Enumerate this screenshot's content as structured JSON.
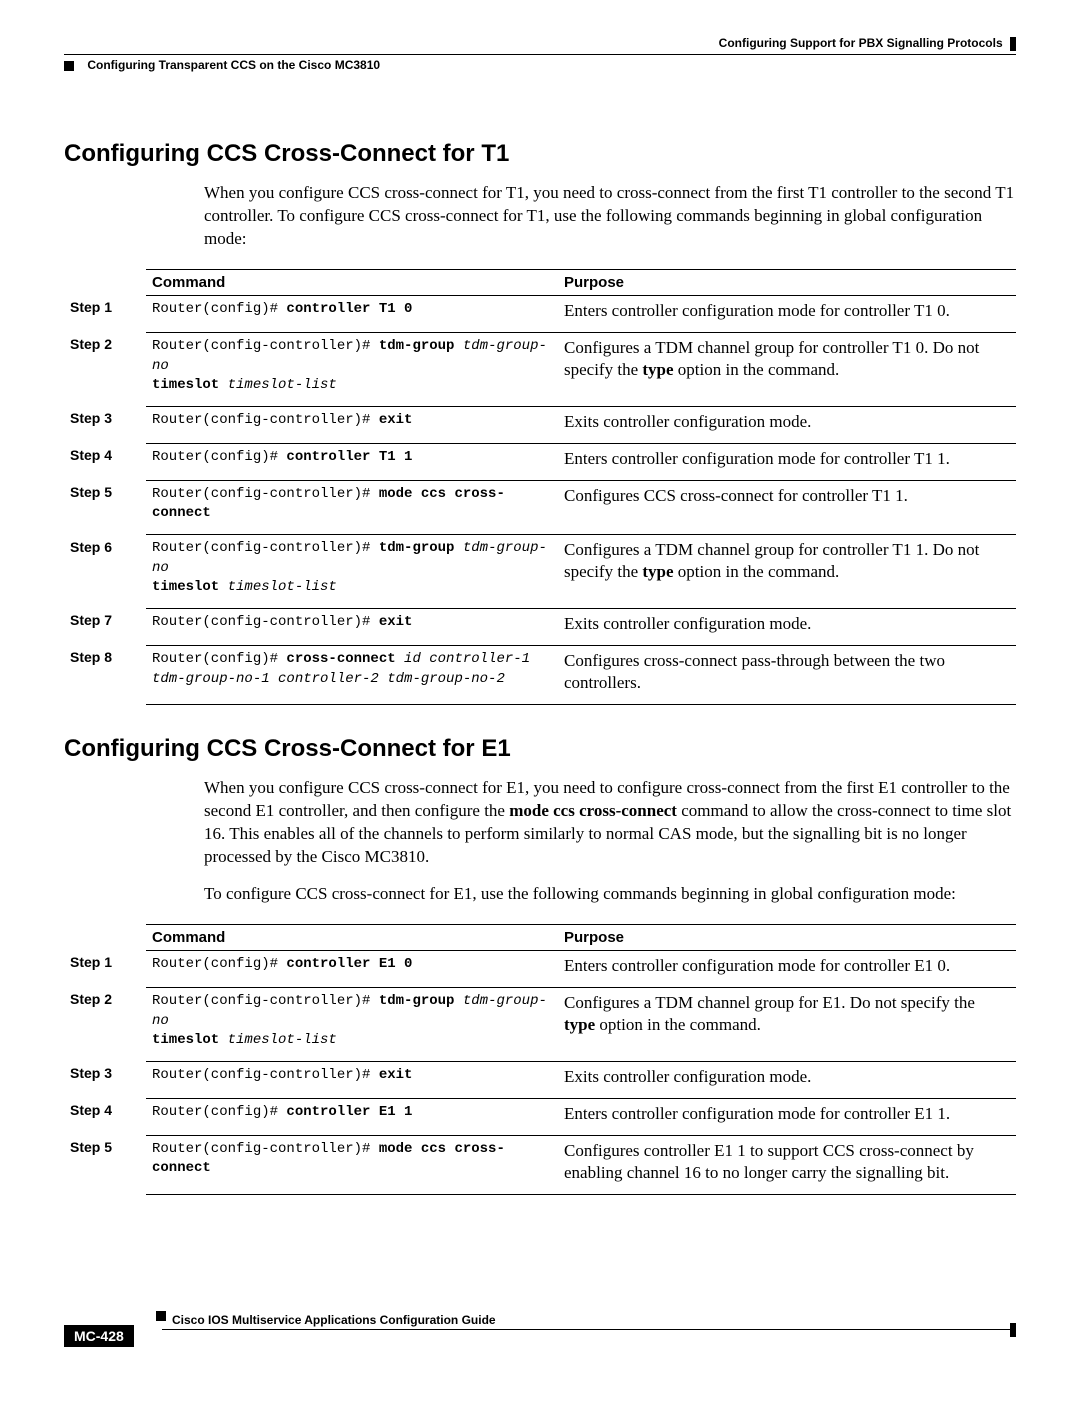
{
  "header": {
    "chapter": "Configuring Support for PBX Signalling Protocols",
    "section": "Configuring Transparent CCS on the Cisco MC3810"
  },
  "t1": {
    "title": "Configuring CCS Cross-Connect for T1",
    "intro": "When you configure CCS cross-connect for T1, you need to cross-connect from the first T1 controller to the second T1 controller. To configure CCS cross-connect for T1, use the following commands beginning in global configuration mode:",
    "th_step": "",
    "th_command": "Command",
    "th_purpose": "Purpose",
    "rows": [
      {
        "step": "Step 1",
        "prompt": "Router(config)# ",
        "cmd_bold": "controller T1 0",
        "cmd_args": "",
        "line2_bold": "",
        "line2_args": "",
        "purpose_a": "Enters controller configuration mode for controller T1 0.",
        "purpose_b": ""
      },
      {
        "step": "Step 2",
        "prompt": "Router(config-controller)# ",
        "cmd_bold": "tdm-group",
        "cmd_args": " tdm-group-no",
        "line2_bold": "timeslot",
        "line2_args": " timeslot-list",
        "purpose_a": "Configures a TDM channel group for controller T1 0. Do not specify the ",
        "purpose_bold": "type",
        "purpose_b": " option in the command."
      },
      {
        "step": "Step 3",
        "prompt": "Router(config-controller)# ",
        "cmd_bold": "exit",
        "cmd_args": "",
        "line2_bold": "",
        "line2_args": "",
        "purpose_a": "Exits controller configuration mode.",
        "purpose_b": ""
      },
      {
        "step": "Step 4",
        "prompt": "Router(config)# ",
        "cmd_bold": "controller T1 1",
        "cmd_args": "",
        "line2_bold": "",
        "line2_args": "",
        "purpose_a": "Enters controller configuration mode for controller T1 1.",
        "purpose_b": ""
      },
      {
        "step": "Step 5",
        "prompt": "Router(config-controller)# ",
        "cmd_bold": "mode ccs cross-connect",
        "cmd_args": "",
        "line2_bold": "",
        "line2_args": "",
        "purpose_a": "Configures CCS cross-connect for controller T1 1.",
        "purpose_b": ""
      },
      {
        "step": "Step 6",
        "prompt": "Router(config-controller)# ",
        "cmd_bold": "tdm-group",
        "cmd_args": " tdm-group-no",
        "line2_bold": "timeslot",
        "line2_args": " timeslot-list",
        "purpose_a": "Configures a TDM channel group for controller T1 1. Do not specify the ",
        "purpose_bold": "type",
        "purpose_b": " option in the command."
      },
      {
        "step": "Step 7",
        "prompt": "Router(config-controller)# ",
        "cmd_bold": "exit",
        "cmd_args": "",
        "line2_bold": "",
        "line2_args": "",
        "purpose_a": "Exits controller configuration mode.",
        "purpose_b": ""
      },
      {
        "step": "Step 8",
        "prompt": "Router(config)# ",
        "cmd_bold": "cross-connect",
        "cmd_args": " id controller-1 tdm-group-no-1 controller-2 tdm-group-no-2",
        "line2_bold": "",
        "line2_args": "",
        "purpose_a": "Configures cross-connect pass-through between the two controllers.",
        "purpose_b": ""
      }
    ]
  },
  "e1": {
    "title": "Configuring CCS Cross-Connect for E1",
    "intro1a": "When you configure CCS cross-connect for E1, you need to configure cross-connect from the first E1 controller to the second E1 controller, and then configure the ",
    "intro1_bold": "mode ccs cross-connect",
    "intro1b": " command to allow the cross-connect to time slot 16. This enables all of the channels to perform similarly to normal CAS mode, but the signalling bit is no longer processed by the Cisco MC3810.",
    "intro2": "To configure CCS cross-connect for E1, use the following commands beginning in global configuration mode:",
    "th_command": "Command",
    "th_purpose": "Purpose",
    "rows": [
      {
        "step": "Step 1",
        "prompt": "Router(config)# ",
        "cmd_bold": "controller E1 0",
        "cmd_args": "",
        "line2_bold": "",
        "line2_args": "",
        "purpose_a": "Enters controller configuration mode for controller E1 0.",
        "purpose_b": ""
      },
      {
        "step": "Step 2",
        "prompt": "Router(config-controller)# ",
        "cmd_bold": "tdm-group",
        "cmd_args": " tdm-group-no",
        "line2_bold": "timeslot",
        "line2_args": " timeslot-list",
        "purpose_a": "Configures a TDM channel group for E1. Do not specify the ",
        "purpose_bold": "type",
        "purpose_b": " option in the command."
      },
      {
        "step": "Step 3",
        "prompt": "Router(config-controller)# ",
        "cmd_bold": "exit",
        "cmd_args": "",
        "line2_bold": "",
        "line2_args": "",
        "purpose_a": "Exits controller configuration mode.",
        "purpose_b": ""
      },
      {
        "step": "Step 4",
        "prompt": "Router(config)# ",
        "cmd_bold": "controller E1 1",
        "cmd_args": "",
        "line2_bold": "",
        "line2_args": "",
        "purpose_a": "Enters controller configuration mode for controller E1 1.",
        "purpose_b": ""
      },
      {
        "step": "Step 5",
        "prompt": "Router(config-controller)# ",
        "cmd_bold": "mode ccs cross-connect",
        "cmd_args": "",
        "line2_bold": "",
        "line2_args": "",
        "purpose_a": "Configures controller E1 1 to support CCS cross-connect by enabling channel 16 to no longer carry the signalling bit.",
        "purpose_b": ""
      }
    ]
  },
  "footer": {
    "guide": "Cisco IOS Multiservice Applications Configuration Guide",
    "page": "MC-428"
  }
}
